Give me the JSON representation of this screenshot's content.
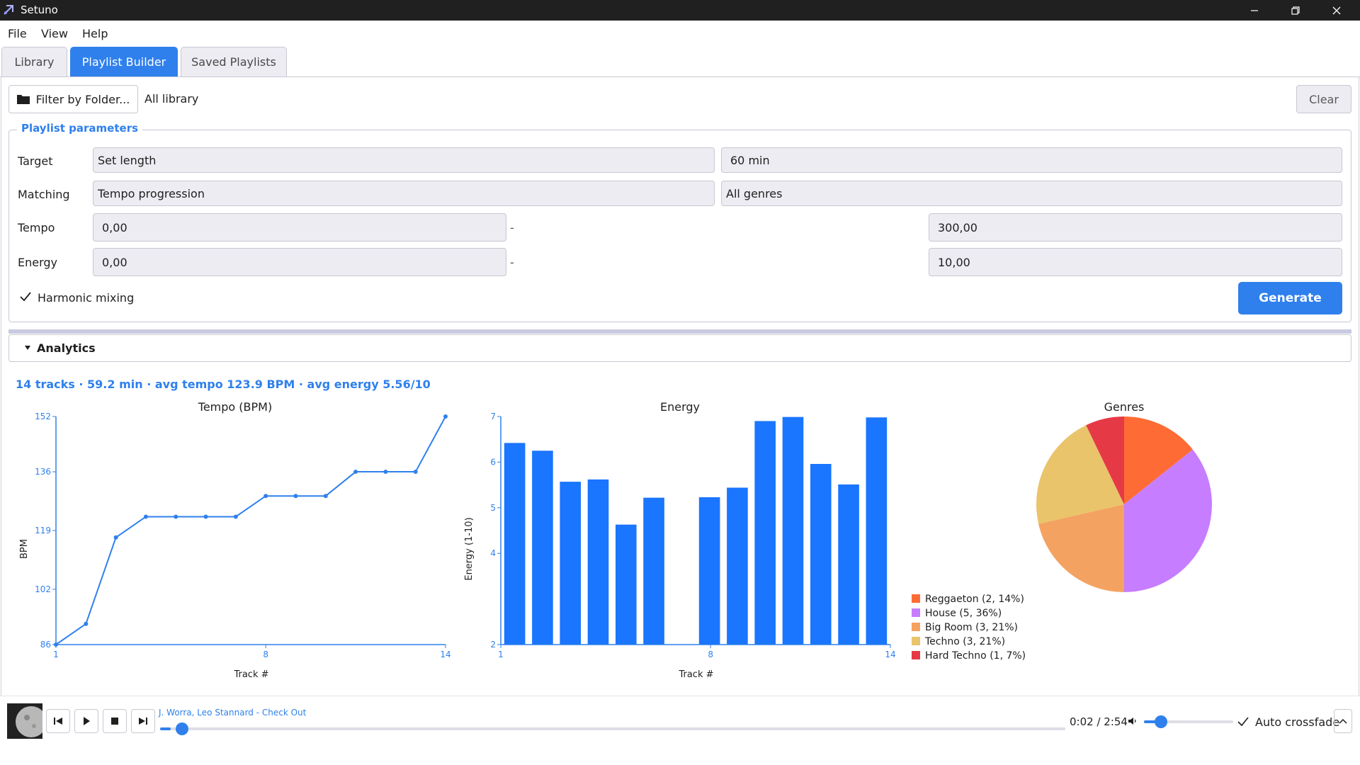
{
  "window": {
    "title": "Setuno"
  },
  "menu": {
    "file": "File",
    "view": "View",
    "help": "Help"
  },
  "tabs": [
    {
      "label": "Library",
      "active": false
    },
    {
      "label": "Playlist Builder",
      "active": true
    },
    {
      "label": "Saved Playlists",
      "active": false
    }
  ],
  "filter": {
    "button_label": "Filter by Folder...",
    "scope": "All library",
    "clear_label": "Clear"
  },
  "params": {
    "group_title": "Playlist parameters",
    "target": {
      "label": "Target",
      "mode": "Set length",
      "value": "60 min"
    },
    "matching": {
      "label": "Matching",
      "mode": "Tempo progression",
      "genre": "All genres"
    },
    "tempo": {
      "label": "Tempo",
      "min": "0,00",
      "separator": "-",
      "max": "300,00"
    },
    "energy": {
      "label": "Energy",
      "min": "0,00",
      "separator": "-",
      "max": "10,00"
    },
    "harmonic": {
      "label": "Harmonic mixing",
      "checked": true
    },
    "generate_label": "Generate"
  },
  "analytics": {
    "title": "Analytics",
    "summary": "14 tracks · 59.2 min · avg tempo 123.9 BPM · avg energy 5.56/10"
  },
  "chart_data": [
    {
      "type": "line",
      "title": "Tempo (BPM)",
      "xlabel": "Track #",
      "ylabel": "BPM",
      "x": [
        1,
        2,
        3,
        4,
        5,
        6,
        7,
        8,
        9,
        10,
        11,
        12,
        13,
        14
      ],
      "values": [
        86,
        92,
        117,
        123,
        123,
        123,
        123,
        129,
        129,
        129,
        136,
        136,
        136,
        152
      ],
      "xlim": [
        1,
        14
      ],
      "ylim": [
        86,
        152
      ],
      "xticks": [
        "1",
        "8",
        "14"
      ],
      "yticks": [
        "86",
        "102",
        "119",
        "136",
        "152"
      ],
      "color": "#2f80ed"
    },
    {
      "type": "bar",
      "title": "Energy",
      "xlabel": "Track #",
      "ylabel": "Energy (1-10)",
      "x": [
        1,
        2,
        3,
        4,
        5,
        6,
        7,
        8,
        9,
        10,
        11,
        12,
        13,
        14
      ],
      "values": [
        6.42,
        6.25,
        5.57,
        5.62,
        4.63,
        5.22,
        2.0,
        5.23,
        5.44,
        6.9,
        6.99,
        5.96,
        5.51,
        6.98
      ],
      "xlim": [
        1,
        14
      ],
      "ylim": [
        2,
        7
      ],
      "xticks": [
        "1",
        "8",
        "14"
      ],
      "yticks": [
        "2",
        "4",
        "5",
        "6",
        "7"
      ],
      "color": "#1a75ff"
    },
    {
      "type": "pie",
      "title": "Genres",
      "slices": [
        {
          "label": "Reggaeton (2, 14%)",
          "value": 2,
          "color": "#ff6b35"
        },
        {
          "label": "House (5, 36%)",
          "value": 5,
          "color": "#c77dff"
        },
        {
          "label": "Big Room (3, 21%)",
          "value": 3,
          "color": "#f4a261"
        },
        {
          "label": "Techno (3, 21%)",
          "value": 3,
          "color": "#e9c46a"
        },
        {
          "label": "Hard Techno (1, 7%)",
          "value": 1,
          "color": "#e63946"
        }
      ],
      "legend": "bottom-left"
    }
  ],
  "player": {
    "track": "J. Worra, Leo Stannard - Check Out",
    "time": "0:02 / 2:54",
    "progress": 0.012,
    "volume": 0.19,
    "crossfade_label": "Auto crossfade",
    "crossfade_checked": true
  }
}
